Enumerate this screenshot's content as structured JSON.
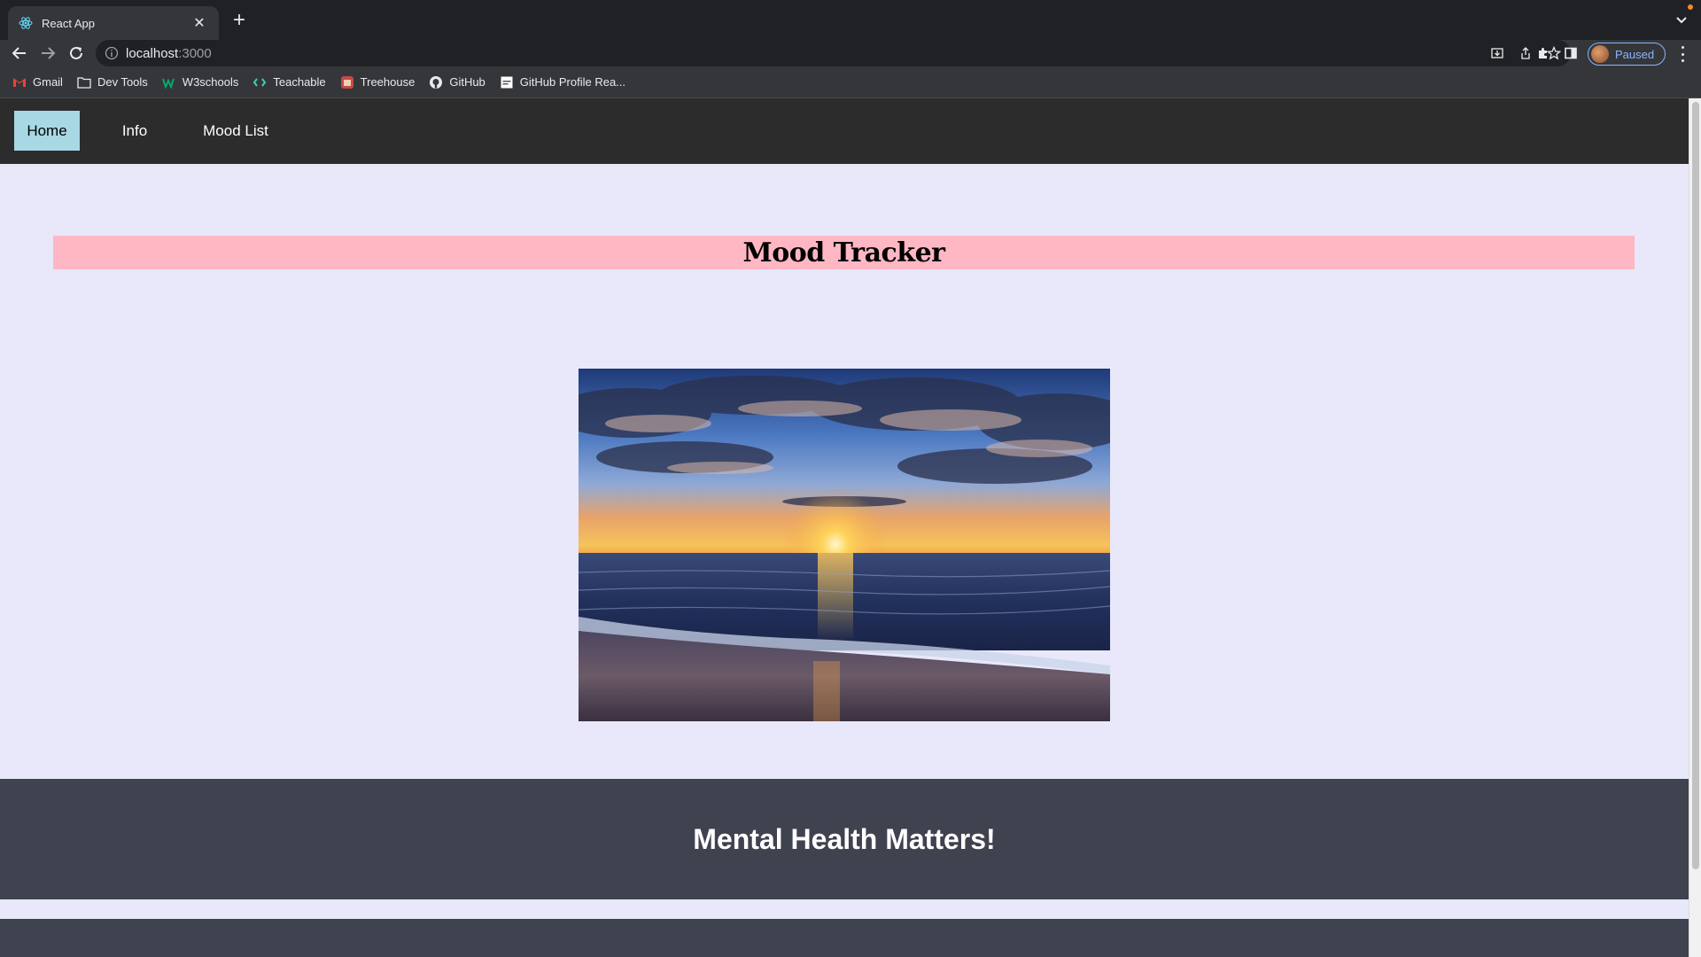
{
  "browser": {
    "tab_title": "React App",
    "url_host": "localhost",
    "url_port": ":3000",
    "profile_label": "Paused"
  },
  "bookmarks": [
    {
      "label": "Gmail",
      "icon": "gmail-icon"
    },
    {
      "label": "Dev Tools",
      "icon": "folder-icon"
    },
    {
      "label": "W3schools",
      "icon": "w3schools-icon"
    },
    {
      "label": "Teachable",
      "icon": "teachable-icon"
    },
    {
      "label": "Treehouse",
      "icon": "treehouse-icon"
    },
    {
      "label": "GitHub",
      "icon": "github-icon"
    },
    {
      "label": "GitHub Profile Rea...",
      "icon": "page-icon"
    }
  ],
  "nav": {
    "home": "Home",
    "info": "Info",
    "mood_list": "Mood List",
    "active": "Home"
  },
  "main": {
    "title": "Mood Tracker",
    "image_icon": "beach-sunset-photo"
  },
  "footer": {
    "text": "Mental Health Matters!"
  },
  "colors": {
    "nav_bg": "#2c2c2c",
    "nav_active": "#a8d8e3",
    "page_bg": "#e8e8fa",
    "title_banner": "#ffb7c3",
    "footer_bg": "#3f4350"
  }
}
